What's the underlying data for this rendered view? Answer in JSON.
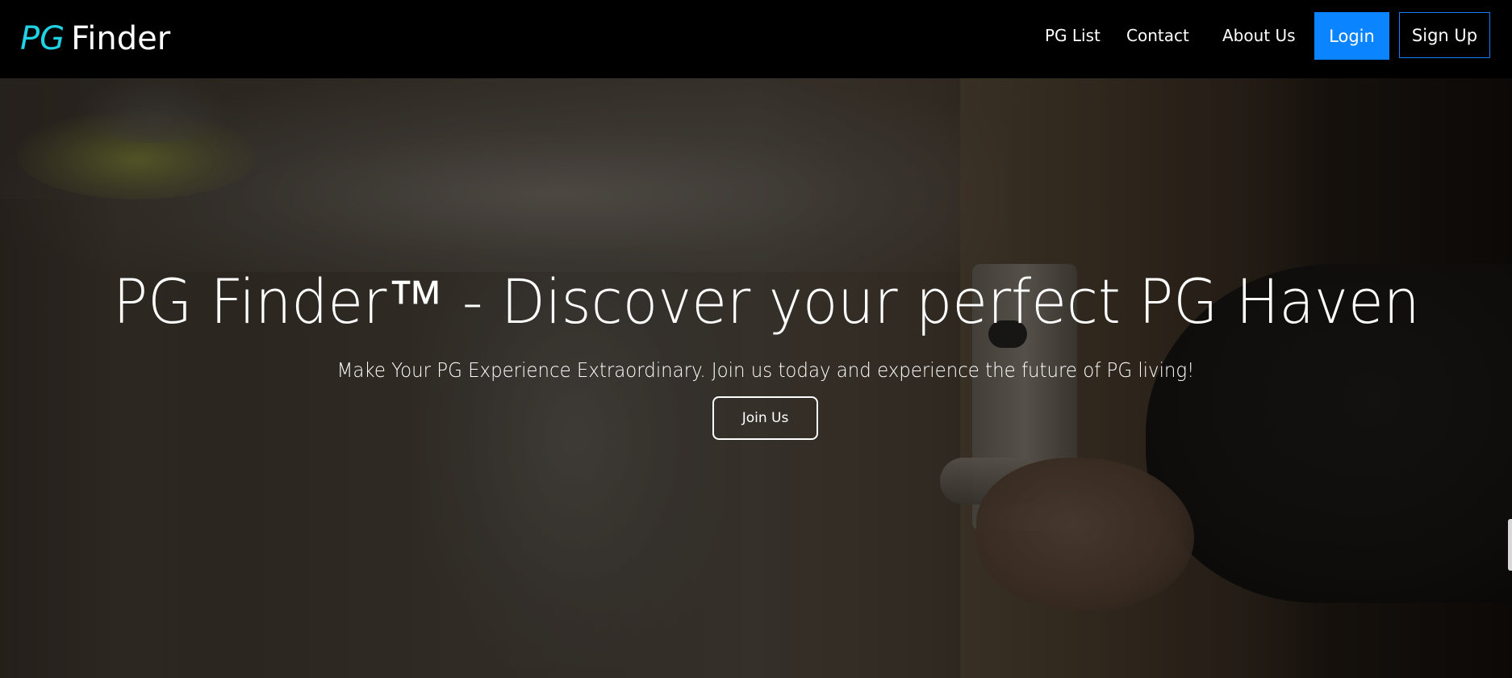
{
  "navbar": {
    "brand_pg": "PG",
    "brand_finder": "Finder",
    "links": {
      "pg_list": "PG List",
      "contact": "Contact",
      "about": "About Us"
    },
    "login_label": "Login",
    "signup_label": "Sign Up"
  },
  "hero": {
    "title": "PG Finder™ - Discover your perfect PG Haven",
    "subtitle": "Make Your PG Experience Extraordinary. Join us today and experience the future of PG living!",
    "join_label": "Join Us"
  },
  "colors": {
    "brand_accent": "#1fd3e4",
    "login_button": "#0a84ff",
    "signup_border": "#1a7bff",
    "navbar_background": "#000000"
  }
}
